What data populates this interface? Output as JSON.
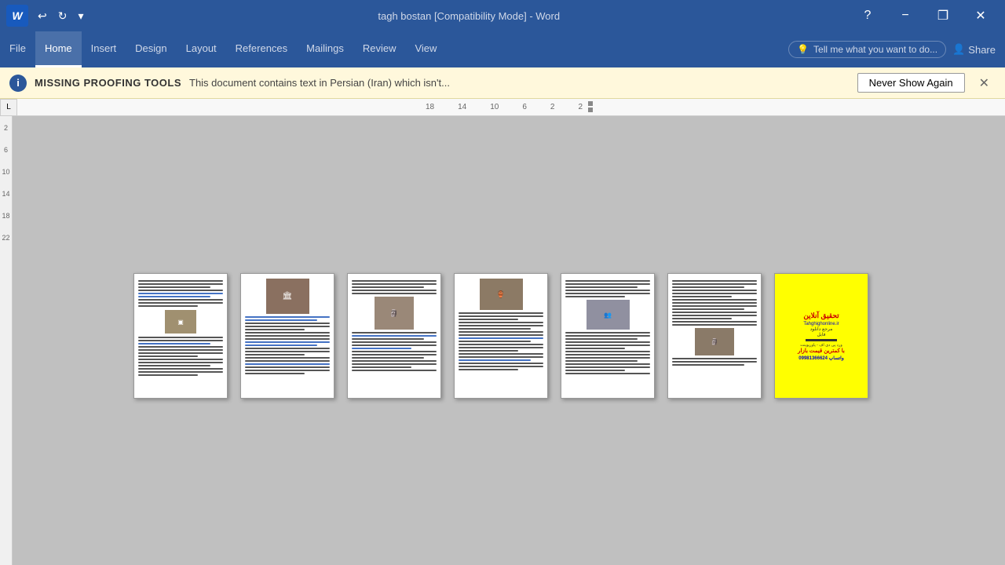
{
  "titlebar": {
    "title": "tagh bostan [Compatibility Mode] - Word",
    "minimize_label": "−",
    "restore_label": "❐",
    "close_label": "✕",
    "word_letter": "W"
  },
  "ribbon": {
    "tabs": [
      "File",
      "Home",
      "Insert",
      "Design",
      "Layout",
      "References",
      "Mailings",
      "Review",
      "View"
    ],
    "active_tab": "Home",
    "tell_me": "Tell me what you want to do...",
    "share": "Share"
  },
  "notification": {
    "title": "MISSING PROOFING TOOLS",
    "text": "This document contains text in Persian (Iran) which isn't...",
    "button": "Never Show Again",
    "close": "✕"
  },
  "ruler": {
    "numbers": [
      "18",
      "14",
      "10",
      "6",
      "2",
      "2"
    ]
  },
  "left_ruler": {
    "numbers": [
      "2",
      "6",
      "10",
      "14",
      "18",
      "22"
    ]
  },
  "pages": [
    {
      "id": 1,
      "type": "text_image",
      "has_image": true
    },
    {
      "id": 2,
      "type": "text_image",
      "has_image": true
    },
    {
      "id": 3,
      "type": "text_image",
      "has_image": true
    },
    {
      "id": 4,
      "type": "text_image",
      "has_image": true
    },
    {
      "id": 5,
      "type": "text_only",
      "has_image": false
    },
    {
      "id": 6,
      "type": "text_image",
      "has_image": true
    },
    {
      "id": 7,
      "type": "ad",
      "has_image": false
    }
  ],
  "ad_page": {
    "title": "تحقیق آنلاین",
    "line1": "Tahghighonline.ir",
    "line2": "مرجع دانلود",
    "line3": "فایل",
    "line4": "ورد پی دی اف - پاورپوینت",
    "line5": "با کمترین قیمت بازار",
    "phone": "واتساپ 09981366624"
  }
}
